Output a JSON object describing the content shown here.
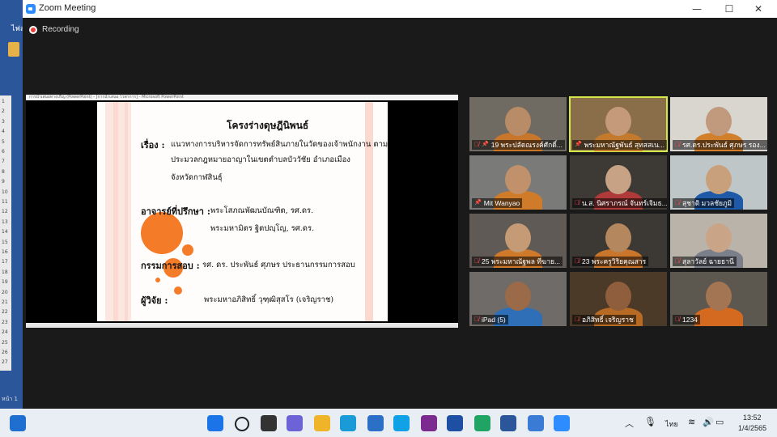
{
  "background_app": {
    "tab_label": "ไฟล",
    "ruler_numbers": [
      "1",
      "2",
      "3",
      "4",
      "5",
      "6",
      "7",
      "8",
      "9",
      "10",
      "11",
      "12",
      "13",
      "14",
      "15",
      "16",
      "17",
      "18",
      "19",
      "20",
      "21",
      "22",
      "23",
      "24",
      "25",
      "26",
      "27"
    ],
    "page_label": "หน้า 1"
  },
  "window": {
    "title": "Zoom Meeting",
    "minimize": "—",
    "maximize": "☐",
    "close": "✕"
  },
  "recording": {
    "label": "Recording"
  },
  "share": {
    "pp_title": "การนำเสนอทางปริญ (PowerPoint) - [การนำเสนอ ไวพาการ] - Microsoft PowerPoint",
    "slide": {
      "title": "โครงร่างดุษฎีนิพนธ์",
      "topic_label": "เรื่อง :",
      "topic_line1": "แนวทางการบริหารจัดการทรัพย์สินภายในวัดของเจ้าพนักงาน   ตาม",
      "topic_line2": "ประมวลกฎหมายอาญาในเขตตำบลบัววัชัย อำเภอเมือง",
      "topic_line3": "จังหวัดกาฬสินธุ์",
      "advisor_label": "อาจารย์ที่ปรึกษา :",
      "advisor1": "พระโสภณพัฒนบัณฑิต, รศ.ดร.",
      "advisor2": "พระมหามิตร ฐิตปญฺโญ, รศ.ดร.",
      "committee_label": "กรรมการสอบ :",
      "committee": "รศ. ดร. ประพันธ์ ศุภษร ประธานกรรมการสอบ",
      "researcher_label": "ผู้วิจัย :",
      "researcher": "พระมหาอภิสิทธิ์ วุฑฺฒิสุสโร (เจริญราช)"
    }
  },
  "participants": [
    {
      "name": "19 พระปลัดณรงค์ศักดิ์...",
      "muted": true,
      "pinned": true,
      "active": false,
      "bg": "#6f6a62",
      "skin": "#b88c67",
      "shirt": "#c8762c"
    },
    {
      "name": "พระมหาณัฐพันธ์ สุทสสเน...",
      "muted": false,
      "pinned": true,
      "active": true,
      "bg": "#8a6e4a",
      "skin": "#c59a7a",
      "shirt": "#c47a2c"
    },
    {
      "name": "รศ.ดร.ประพันธ์ ศุภษร รอง...",
      "muted": true,
      "pinned": false,
      "active": false,
      "bg": "#d9d6d0",
      "skin": "#c19a7e",
      "shirt": "#d27f2c"
    },
    {
      "name": "Mit Wanyao",
      "muted": false,
      "pinned": true,
      "active": false,
      "bg": "#7a7a78",
      "skin": "#c0916a",
      "shirt": "#d07b2a"
    },
    {
      "name": "น.ส. นิศราภรณ์ จันทร์เจิมธ...",
      "muted": true,
      "pinned": false,
      "active": false,
      "bg": "#3d3a36",
      "skin": "#c8a285",
      "shirt": "#b03a3a"
    },
    {
      "name": "สุชาติ มวลชัยภูมิ",
      "muted": true,
      "pinned": false,
      "active": false,
      "bg": "#bfc6c8",
      "skin": "#c9a07c",
      "shirt": "#1e5aa8"
    },
    {
      "name": "25  พระมหาณัฐพล  ทีฆาย...",
      "muted": true,
      "pinned": false,
      "active": false,
      "bg": "#5f5a55",
      "skin": "#c49b74",
      "shirt": "#cf7a2b"
    },
    {
      "name": "23  พระครูวิริยคุณสาร",
      "muted": true,
      "pinned": false,
      "active": false,
      "bg": "#3c3834",
      "skin": "#b5875f",
      "shirt": "#c9762a"
    },
    {
      "name": "สุลาวัลย์ ฉายธานี",
      "muted": true,
      "pinned": false,
      "active": false,
      "bg": "#b9b3aa",
      "skin": "#c9a487",
      "shirt": "#7a7f8a"
    },
    {
      "name": "iPad (5)",
      "muted": true,
      "pinned": false,
      "active": false,
      "bg": "#6f6b68",
      "skin": "#9b6a48",
      "shirt": "#2e6fb8"
    },
    {
      "name": "อภิสิทธิ์ เจริญราช",
      "muted": true,
      "pinned": false,
      "active": false,
      "bg": "#4b3a28",
      "skin": "#8f5e3d",
      "shirt": "#b76a24"
    },
    {
      "name": "1234",
      "muted": true,
      "pinned": false,
      "active": false,
      "bg": "#5c5850",
      "skin": "#a47552",
      "shirt": "#d36a1f"
    }
  ],
  "taskbar": {
    "input_lang": "ไทย",
    "time": "13:52",
    "date": "1/4/2565",
    "colors": {
      "accent": "#2d8cff",
      "record": "#e8403a",
      "slide_circle": "#f47b28",
      "active_outline": "#d4e84a"
    }
  }
}
